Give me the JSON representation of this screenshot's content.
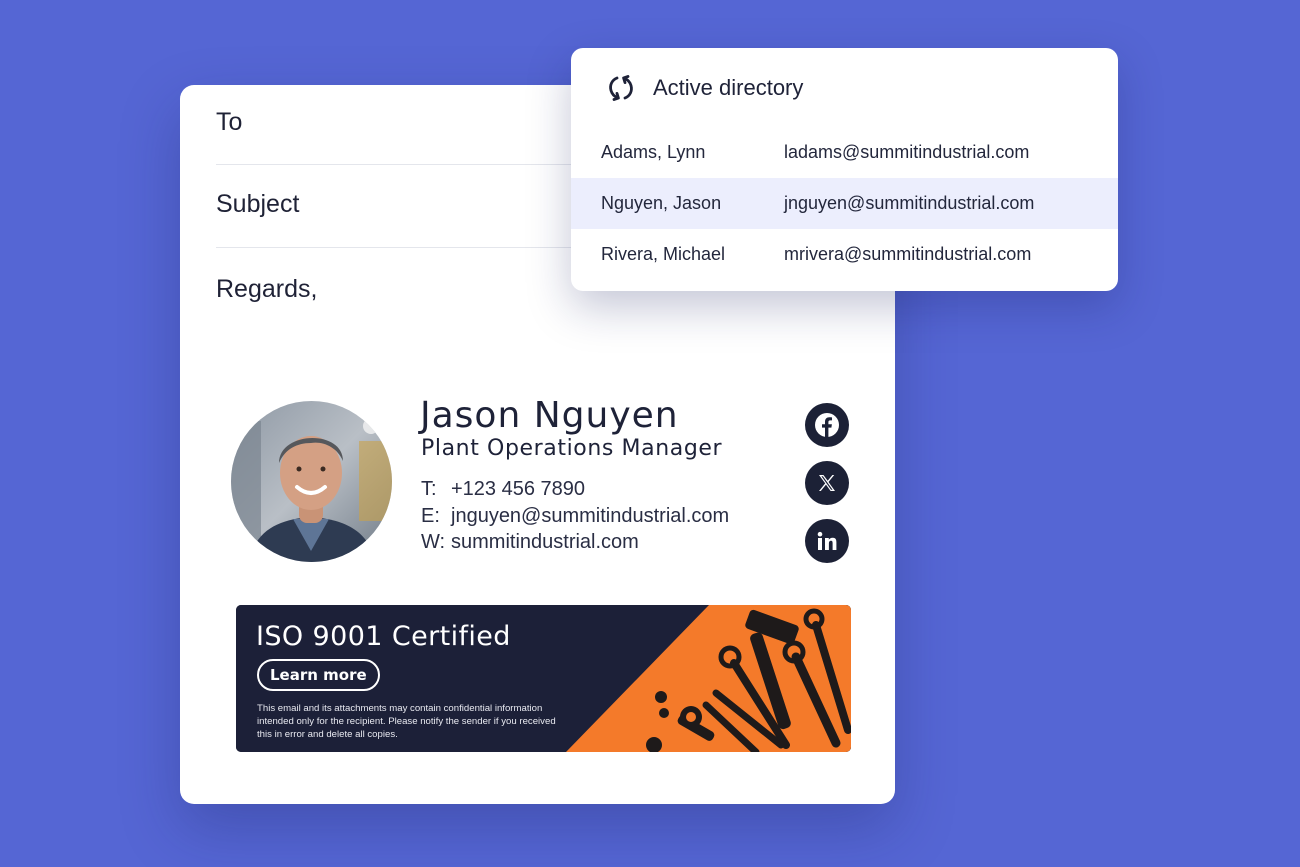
{
  "composer": {
    "to_label": "To",
    "subject_label": "Subject",
    "body_text": "Regards,"
  },
  "signature": {
    "name": "Jason Nguyen",
    "title": "Plant Operations Manager",
    "phone_label": "T:",
    "phone": "+123 456 7890",
    "email_label": "E:",
    "email": "jnguyen@summitindustrial.com",
    "web_label": "W:",
    "website": "summitindustrial.com",
    "social_icons": [
      "facebook-icon",
      "x-icon",
      "linkedin-icon"
    ]
  },
  "banner": {
    "title": "ISO 9001 Certified",
    "button_label": "Learn more",
    "disclaimer": "This email and its attachments may contain confidential information intended only for the recipient. Please notify the sender if you received this in error and delete all copies.",
    "accent_color": "#f47a2a",
    "dark_color": "#1c2038"
  },
  "directory": {
    "title": "Active directory",
    "icon": "sync-icon",
    "entries": [
      {
        "name": "Adams, Lynn",
        "email": "ladams@summitindustrial.com",
        "selected": false
      },
      {
        "name": "Nguyen, Jason",
        "email": "jnguyen@summitindustrial.com",
        "selected": true
      },
      {
        "name": "Rivera, Michael",
        "email": "mrivera@summitindustrial.com",
        "selected": false
      }
    ]
  },
  "colors": {
    "background": "#5566d4",
    "selected_row": "#eceefd",
    "social_bg": "#1c2136"
  }
}
